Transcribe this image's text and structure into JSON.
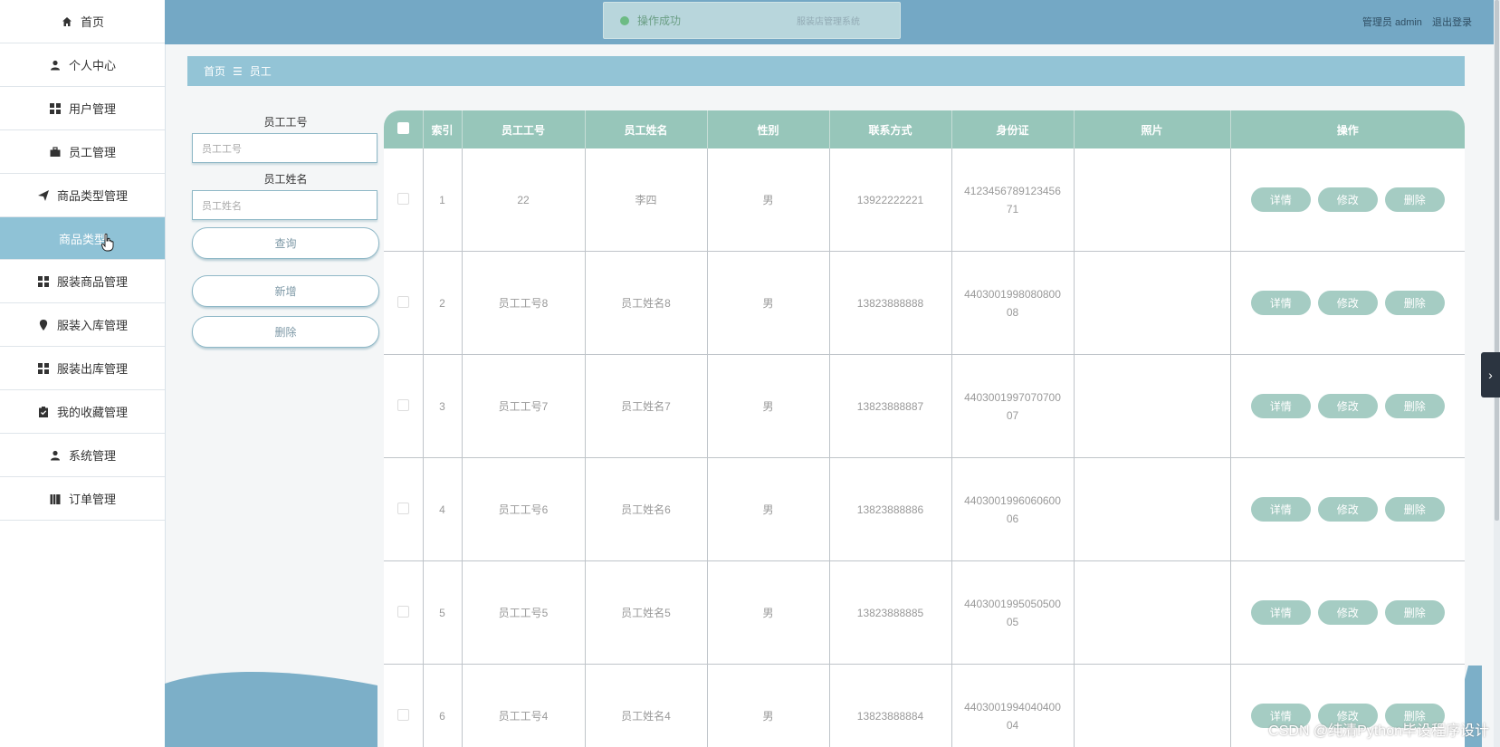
{
  "sidebar": {
    "items": [
      {
        "label": "首页",
        "icon": "home-icon"
      },
      {
        "label": "个人中心",
        "icon": "user-icon"
      },
      {
        "label": "用户管理",
        "icon": "grid-icon"
      },
      {
        "label": "员工管理",
        "icon": "briefcase-icon"
      },
      {
        "label": "商品类型管理",
        "icon": "send-icon"
      },
      {
        "label": "商品类型",
        "icon": ""
      },
      {
        "label": "服装商品管理",
        "icon": "grid-icon"
      },
      {
        "label": "服装入库管理",
        "icon": "location-icon"
      },
      {
        "label": "服装出库管理",
        "icon": "grid-icon"
      },
      {
        "label": "我的收藏管理",
        "icon": "clipboard-check-icon"
      },
      {
        "label": "系统管理",
        "icon": "user-icon"
      },
      {
        "label": "订单管理",
        "icon": "books-icon"
      }
    ]
  },
  "header": {
    "toast": "操作成功",
    "system_title": "服装店管理系统",
    "user": "管理员 admin",
    "logout": "退出登录"
  },
  "breadcrumb": {
    "home": "首页",
    "separator": "☰",
    "current": "员工"
  },
  "search": {
    "emp_no_label": "员工工号",
    "emp_no_placeholder": "员工工号",
    "emp_name_label": "员工姓名",
    "emp_name_placeholder": "员工姓名",
    "query": "查询",
    "add": "新增",
    "delete": "删除"
  },
  "table": {
    "headers": [
      "索引",
      "员工工号",
      "员工姓名",
      "性别",
      "联系方式",
      "身份证",
      "照片",
      "操作"
    ],
    "actions": {
      "detail": "详情",
      "edit": "修改",
      "delete": "删除"
    },
    "rows": [
      {
        "index": "1",
        "no": "22",
        "name": "李四",
        "gender": "男",
        "phone": "13922222221",
        "id_line1": "4123456789123456",
        "id_line2": "71"
      },
      {
        "index": "2",
        "no": "员工工号8",
        "name": "员工姓名8",
        "gender": "男",
        "phone": "13823888888",
        "id_line1": "4403001998080800",
        "id_line2": "08"
      },
      {
        "index": "3",
        "no": "员工工号7",
        "name": "员工姓名7",
        "gender": "男",
        "phone": "13823888887",
        "id_line1": "4403001997070700",
        "id_line2": "07"
      },
      {
        "index": "4",
        "no": "员工工号6",
        "name": "员工姓名6",
        "gender": "男",
        "phone": "13823888886",
        "id_line1": "4403001996060600",
        "id_line2": "06"
      },
      {
        "index": "5",
        "no": "员工工号5",
        "name": "员工姓名5",
        "gender": "男",
        "phone": "13823888885",
        "id_line1": "4403001995050500",
        "id_line2": "05"
      },
      {
        "index": "6",
        "no": "员工工号4",
        "name": "员工姓名4",
        "gender": "男",
        "phone": "13823888884",
        "id_line1": "4403001994040400",
        "id_line2": "04"
      }
    ]
  },
  "watermark": "CSDN @纯清Python毕设程序设计",
  "colors": {
    "topbar": "#74a8c5",
    "breadcrumb": "#93c4d6",
    "table_header": "#97c6ba",
    "action_button": "#a5ccc3"
  }
}
